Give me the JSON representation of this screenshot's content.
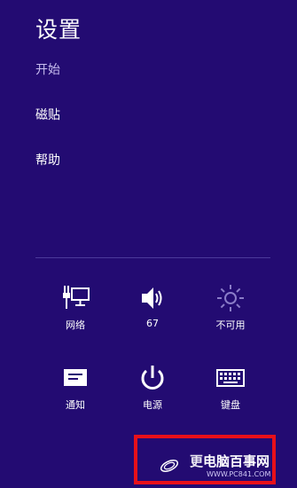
{
  "panel": {
    "title": "设置",
    "background": "#230b72"
  },
  "menu": {
    "items": [
      {
        "label": "开始"
      },
      {
        "label": "磁贴"
      },
      {
        "label": "帮助"
      }
    ]
  },
  "quick_settings": {
    "row1": [
      {
        "label": "网络",
        "icon": "network-monitor-icon"
      },
      {
        "label": "67",
        "icon": "volume-icon"
      },
      {
        "label": "不可用",
        "icon": "brightness-icon"
      }
    ],
    "row2": [
      {
        "label": "通知",
        "icon": "notifications-icon"
      },
      {
        "label": "电源",
        "icon": "power-icon"
      },
      {
        "label": "键盘",
        "icon": "keyboard-icon"
      }
    ]
  },
  "overlay": {
    "highlight_color": "#e8101a",
    "watermark_text": "电脑百事网",
    "watermark_prefix": "更",
    "watermark_url": "WWW.PC841.COM"
  }
}
